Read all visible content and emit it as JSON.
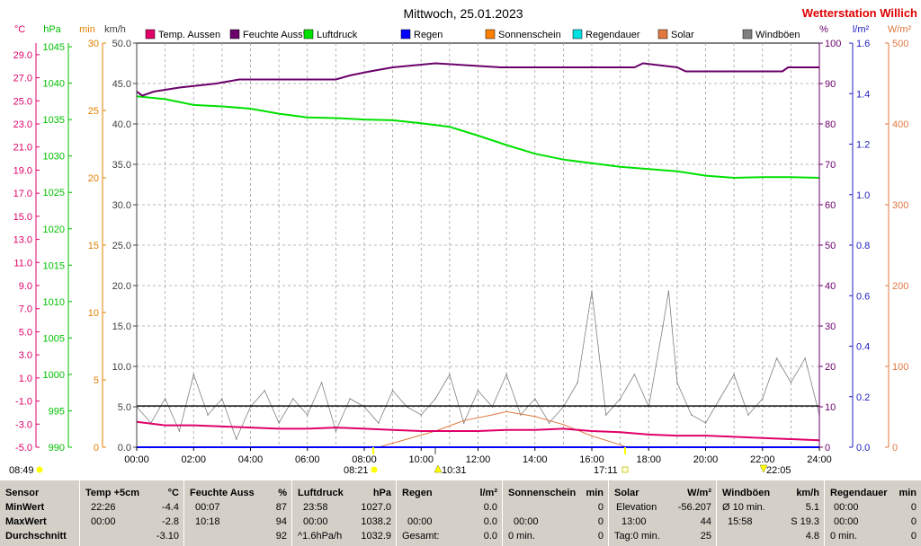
{
  "window": {
    "title": "Mittwoch, 25.01.2023",
    "brand": "Wetterstation Willich"
  },
  "legend": [
    {
      "label": "Temp. Aussen",
      "color": "#e0006a"
    },
    {
      "label": "Feuchte Auss*",
      "color": "#6a006a"
    },
    {
      "label": "Luftdruck",
      "color": "#00e000"
    },
    {
      "label": "Regen",
      "color": "#0000ff"
    },
    {
      "label": "Sonnenschein",
      "color": "#ff8000"
    },
    {
      "label": "Regendauer",
      "color": "#00e0e0"
    },
    {
      "label": "Solar",
      "color": "#e07840"
    },
    {
      "label": "Windböen",
      "color": "#808080"
    }
  ],
  "axes": {
    "temp": {
      "unit": "°C",
      "color": "#e0006a",
      "ticks": [
        "29.0",
        "27.0",
        "25.0",
        "23.0",
        "21.0",
        "19.0",
        "17.0",
        "15.0",
        "13.0",
        "11.0",
        "9.0",
        "7.0",
        "5.0",
        "3.0",
        "1.0",
        "-1.0",
        "-3.0",
        "-5.0"
      ]
    },
    "pressure": {
      "unit": "hPa",
      "color": "#00c000",
      "ticks": [
        "1045",
        "1040",
        "1035",
        "1030",
        "1025",
        "1020",
        "1015",
        "1010",
        "1005",
        "1000",
        "995",
        "990"
      ]
    },
    "minutes": {
      "unit": "min",
      "color": "#e08000",
      "ticks": [
        "30",
        "25",
        "20",
        "15",
        "10",
        "5",
        "0"
      ]
    },
    "wind": {
      "unit": "km/h",
      "color": "#404040",
      "ticks": [
        "50.0",
        "45.0",
        "40.0",
        "35.0",
        "30.0",
        "25.0",
        "20.0",
        "15.0",
        "10.0",
        "5.0",
        "0.0"
      ]
    },
    "humidity": {
      "unit": "%",
      "color": "#6a006a",
      "ticks": [
        "100",
        "90",
        "80",
        "70",
        "60",
        "50",
        "40",
        "30",
        "20",
        "10",
        "0"
      ]
    },
    "rain": {
      "unit": "l/m²",
      "color": "#2020c0",
      "ticks": [
        "1.6",
        "1.4",
        "1.2",
        "1.0",
        "0.8",
        "0.6",
        "0.4",
        "0.2",
        "0.0"
      ]
    },
    "solar": {
      "unit": "W/m²",
      "color": "#e07840",
      "ticks": [
        "500",
        "400",
        "300",
        "200",
        "100",
        "0"
      ]
    },
    "time": {
      "ticks": [
        "00:00",
        "02:00",
        "04:00",
        "06:00",
        "08:00",
        "10:00",
        "12:00",
        "14:00",
        "16:00",
        "18:00",
        "20:00",
        "22:00",
        "24:00"
      ]
    }
  },
  "time_markers": {
    "moonrise": "08:49",
    "sunrise": "08:21",
    "moon_culmination": "10:31",
    "sunset": "17:11",
    "moonset": "22:05"
  },
  "chart_data": {
    "type": "line",
    "title": "Mittwoch, 25.01.2023",
    "x_unit": "hours",
    "xlim": [
      0,
      24
    ],
    "series": [
      {
        "name": "Feuchte Auss*",
        "color": "#6a006a",
        "axis": "humidity",
        "ylim": [
          0,
          100
        ],
        "points": [
          [
            0,
            88
          ],
          [
            0.2,
            87
          ],
          [
            0.6,
            88
          ],
          [
            1.5,
            89
          ],
          [
            2.8,
            90
          ],
          [
            3.6,
            91
          ],
          [
            7.0,
            91
          ],
          [
            7.5,
            92
          ],
          [
            8.2,
            93
          ],
          [
            9.0,
            94
          ],
          [
            10.5,
            95
          ],
          [
            12.8,
            94
          ],
          [
            17.5,
            94
          ],
          [
            17.8,
            95
          ],
          [
            19.0,
            94
          ],
          [
            19.3,
            93
          ],
          [
            22.7,
            93
          ],
          [
            22.9,
            94
          ],
          [
            24,
            94
          ]
        ]
      },
      {
        "name": "Luftdruck",
        "color": "#00e000",
        "axis": "pressure",
        "ylim": [
          990,
          1045.5
        ],
        "points": [
          [
            0,
            1038.2
          ],
          [
            1.0,
            1037.8
          ],
          [
            2.0,
            1037.0
          ],
          [
            3.0,
            1036.8
          ],
          [
            4.0,
            1036.5
          ],
          [
            5.0,
            1035.8
          ],
          [
            6.0,
            1035.3
          ],
          [
            7.0,
            1035.2
          ],
          [
            8.0,
            1035.0
          ],
          [
            9.0,
            1034.9
          ],
          [
            10.0,
            1034.5
          ],
          [
            11.0,
            1034.0
          ],
          [
            12.0,
            1032.8
          ],
          [
            13.0,
            1031.5
          ],
          [
            14.0,
            1030.3
          ],
          [
            15.0,
            1029.5
          ],
          [
            16.0,
            1029.0
          ],
          [
            17.0,
            1028.5
          ],
          [
            18.0,
            1028.2
          ],
          [
            19.0,
            1027.9
          ],
          [
            20.0,
            1027.3
          ],
          [
            21.0,
            1027.0
          ],
          [
            22.0,
            1027.1
          ],
          [
            23.0,
            1027.1
          ],
          [
            24,
            1027.0
          ]
        ]
      },
      {
        "name": "Temp. Aussen",
        "color": "#e0006a",
        "axis": "temp",
        "ylim": [
          -5,
          30
        ],
        "points": [
          [
            0,
            -2.8
          ],
          [
            1,
            -3.1
          ],
          [
            2,
            -3.1
          ],
          [
            3,
            -3.2
          ],
          [
            4,
            -3.3
          ],
          [
            5,
            -3.4
          ],
          [
            6,
            -3.4
          ],
          [
            7,
            -3.3
          ],
          [
            8,
            -3.4
          ],
          [
            9,
            -3.5
          ],
          [
            10,
            -3.6
          ],
          [
            11,
            -3.6
          ],
          [
            12,
            -3.6
          ],
          [
            13,
            -3.5
          ],
          [
            14,
            -3.5
          ],
          [
            15,
            -3.4
          ],
          [
            16,
            -3.6
          ],
          [
            17,
            -3.7
          ],
          [
            18,
            -3.9
          ],
          [
            19,
            -4.0
          ],
          [
            20,
            -4.0
          ],
          [
            21,
            -4.1
          ],
          [
            22,
            -4.2
          ],
          [
            23,
            -4.3
          ],
          [
            24,
            -4.4
          ]
        ]
      },
      {
        "name": "Solar",
        "color": "#e07840",
        "axis": "solar",
        "ylim": [
          0,
          500
        ],
        "points": [
          [
            8.5,
            0
          ],
          [
            9.5,
            10
          ],
          [
            10.5,
            20
          ],
          [
            11.5,
            33
          ],
          [
            12.5,
            40
          ],
          [
            13.0,
            44
          ],
          [
            14.0,
            38
          ],
          [
            15.0,
            28
          ],
          [
            16.0,
            14
          ],
          [
            17.0,
            3
          ],
          [
            17.2,
            0
          ]
        ]
      },
      {
        "name": "Regen",
        "color": "#0000ff",
        "axis": "rain",
        "ylim": [
          0,
          1.6
        ],
        "points": [
          [
            0,
            0
          ],
          [
            24,
            0
          ]
        ]
      },
      {
        "name": "Windböen",
        "color": "#808080",
        "axis": "wind",
        "ylim": [
          0,
          50
        ],
        "style": "gust",
        "points": [
          [
            0,
            5
          ],
          [
            0.5,
            3
          ],
          [
            1,
            6
          ],
          [
            1.5,
            2
          ],
          [
            2,
            9
          ],
          [
            2.5,
            4
          ],
          [
            3,
            6
          ],
          [
            3.5,
            1
          ],
          [
            4,
            5
          ],
          [
            4.5,
            7
          ],
          [
            5,
            3
          ],
          [
            5.5,
            6
          ],
          [
            6,
            4
          ],
          [
            6.5,
            8
          ],
          [
            7,
            2
          ],
          [
            7.5,
            6
          ],
          [
            8,
            5
          ],
          [
            8.5,
            3
          ],
          [
            9,
            7
          ],
          [
            9.5,
            5
          ],
          [
            10,
            4
          ],
          [
            10.5,
            6
          ],
          [
            11,
            9
          ],
          [
            11.5,
            3
          ],
          [
            12,
            7
          ],
          [
            12.5,
            5
          ],
          [
            13,
            9
          ],
          [
            13.5,
            4
          ],
          [
            14,
            6
          ],
          [
            14.5,
            3
          ],
          [
            15,
            5
          ],
          [
            15.5,
            8
          ],
          [
            16,
            19.3
          ],
          [
            16.5,
            4
          ],
          [
            17,
            6
          ],
          [
            17.5,
            9
          ],
          [
            18,
            5
          ],
          [
            18.5,
            15
          ],
          [
            18.7,
            19.3
          ],
          [
            19,
            8
          ],
          [
            19.5,
            4
          ],
          [
            20,
            3
          ],
          [
            20.5,
            6
          ],
          [
            21,
            9
          ],
          [
            21.5,
            4
          ],
          [
            22,
            6
          ],
          [
            22.5,
            11
          ],
          [
            23,
            8
          ],
          [
            23.5,
            11
          ],
          [
            24,
            4
          ]
        ]
      }
    ]
  },
  "stats": {
    "columns": [
      {
        "name": "Sensor",
        "rows": [
          "MinWert",
          "MaxWert",
          "Durchschnitt"
        ]
      },
      {
        "name": "Temp +5cm",
        "unit": "°C",
        "rows": [
          [
            "22:26",
            "-4.4"
          ],
          [
            "00:00",
            "-2.8"
          ],
          [
            "",
            "-3.10"
          ]
        ]
      },
      {
        "name": "Feuchte Auss",
        "unit": "%",
        "rows": [
          [
            "00:07",
            "87"
          ],
          [
            "10:18",
            "94"
          ],
          [
            "",
            "92"
          ]
        ]
      },
      {
        "name": "Luftdruck",
        "unit": "hPa",
        "rows": [
          [
            "23:58",
            "1027.0"
          ],
          [
            "00:00",
            "1038.2"
          ],
          [
            "^1.6hPa/h",
            "1032.9"
          ]
        ]
      },
      {
        "name": "Regen",
        "unit": "l/m²",
        "rows": [
          [
            "",
            "0.0"
          ],
          [
            "00:00",
            "0.0"
          ],
          [
            "Gesamt:",
            "0.0"
          ]
        ]
      },
      {
        "name": "Sonnenschein",
        "unit": "min",
        "rows": [
          [
            "",
            "0"
          ],
          [
            "00:00",
            "0"
          ],
          [
            "0 min.",
            "0"
          ]
        ]
      },
      {
        "name": "Solar",
        "unit": "W/m²",
        "rows": [
          [
            "Elevation",
            "-56.207"
          ],
          [
            "13:00",
            "44"
          ],
          [
            "Tag:0 min.",
            "25"
          ]
        ]
      },
      {
        "name": "Windböen",
        "unit": "km/h",
        "rows": [
          [
            "Ø 10 min.",
            "5.1"
          ],
          [
            "15:58",
            "S 19.3"
          ],
          [
            "",
            "4.8"
          ]
        ]
      },
      {
        "name": "Regendauer",
        "unit": "min",
        "rows": [
          [
            "00:00",
            "0"
          ],
          [
            "00:00",
            "0"
          ],
          [
            "0 min.",
            "0"
          ]
        ]
      }
    ]
  }
}
